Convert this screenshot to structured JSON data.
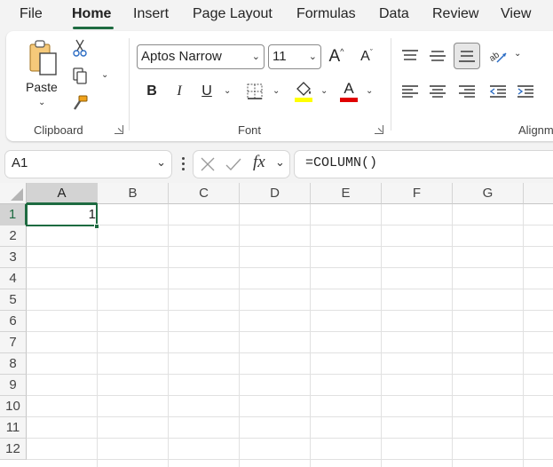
{
  "menu": {
    "tabs": [
      {
        "label": "File"
      },
      {
        "label": "Home"
      },
      {
        "label": "Insert"
      },
      {
        "label": "Page Layout"
      },
      {
        "label": "Formulas"
      },
      {
        "label": "Data"
      },
      {
        "label": "Review"
      },
      {
        "label": "View"
      }
    ],
    "active_tab": "Home"
  },
  "ribbon": {
    "clipboard": {
      "label": "Clipboard",
      "paste_label": "Paste",
      "icons": [
        "paste-icon",
        "cut-icon",
        "copy-icon",
        "format-painter-icon"
      ]
    },
    "font": {
      "label": "Font",
      "font_name": "Aptos Narrow",
      "font_size": "11",
      "grow_glyph": "A",
      "shrink_glyph": "A",
      "bold_glyph": "B",
      "italic_glyph": "I",
      "underline_glyph": "U",
      "font_color_glyph": "A",
      "highlight_color": "#ffff00",
      "font_color": "#e00000"
    },
    "alignment": {
      "label": "Alignm"
    }
  },
  "formula_bar": {
    "name_box": "A1",
    "fx_label": "fx",
    "formula": "=COLUMN()"
  },
  "sheet": {
    "columns": [
      "A",
      "B",
      "C",
      "D",
      "E",
      "F",
      "G"
    ],
    "rows": [
      "1",
      "2",
      "3",
      "4",
      "5",
      "6",
      "7",
      "8",
      "9",
      "10",
      "11",
      "12"
    ],
    "active_cell": "A1",
    "cell_A1_value": "1",
    "accent_color": "#1e6b41"
  }
}
